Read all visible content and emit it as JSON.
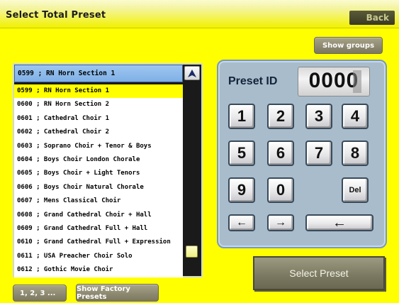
{
  "title": "Select Total Preset",
  "back_label": "Back",
  "show_groups_label": "Show groups",
  "list": {
    "header": "0599 ; RN Horn Section 1",
    "selected_index": 0,
    "items": [
      "0599 ; RN Horn Section 1",
      "0600 ; RN Horn Section 2",
      "0601 ; Cathedral Choir 1",
      "0602 ; Cathedral Choir 2",
      "0603 ; Soprano Choir + Tenor & Boys",
      "0604 ; Boys Choir London Chorale",
      "0605 ; Boys Choir + Light Tenors",
      "0606 ; Boys Choir Natural Chorale",
      "0607 ; Mens Classical Choir",
      "0608 ; Grand Cathedral Choir + Hall",
      "0609 ; Grand Cathedral Full + Hall",
      "0610 ; Grand Cathedral Full + Expression",
      "0611 ; USA Preacher Choir Solo",
      "0612 ; Gothic Movie Choir"
    ]
  },
  "keypad": {
    "label": "Preset ID",
    "value": "0000",
    "keys": {
      "k1": "1",
      "k2": "2",
      "k3": "3",
      "k4": "4",
      "k5": "5",
      "k6": "6",
      "k7": "7",
      "k8": "8",
      "k9": "9",
      "k0": "0",
      "del": "Del",
      "left": "←",
      "right": "→",
      "backspace": "←"
    }
  },
  "select_preset_label": "Select Preset",
  "numbers_label": "1, 2, 3 ...",
  "factory_label": "Show Factory Presets",
  "colors": {
    "background": "#ffff00",
    "list_header": "#8fbbe8",
    "keypad_panel": "#a8bccc",
    "button_olive": "#8c8870"
  }
}
